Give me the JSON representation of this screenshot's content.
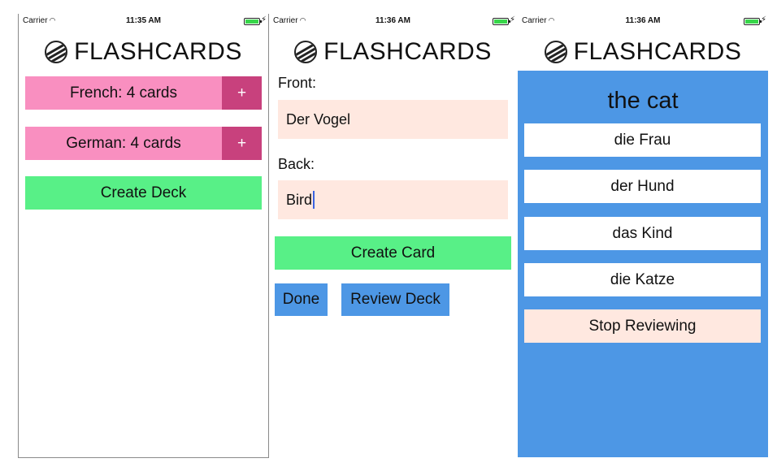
{
  "app_title": "FLASHCARDS",
  "screens": [
    {
      "carrier": "Carrier",
      "time": "11:35 AM"
    },
    {
      "carrier": "Carrier",
      "time": "11:36 AM"
    },
    {
      "carrier": "Carrier",
      "time": "11:36 AM"
    }
  ],
  "decks_screen": {
    "decks": [
      {
        "label": "French: 4 cards",
        "add_label": "+"
      },
      {
        "label": "German: 4 cards",
        "add_label": "+"
      }
    ],
    "create_deck_label": "Create Deck"
  },
  "card_screen": {
    "front_label": "Front:",
    "front_value": "Der Vogel",
    "back_label": "Back:",
    "back_value": "Bird",
    "create_card_label": "Create Card",
    "done_label": "Done",
    "review_deck_label": "Review Deck"
  },
  "review_screen": {
    "prompt": "the cat",
    "choices": [
      "die Frau",
      "der Hund",
      "das Kind",
      "die Katze"
    ],
    "stop_label": "Stop Reviewing",
    "background_color": "#4d97e5"
  },
  "icons": {
    "wifi": "wifi-icon",
    "battery": "battery-icon",
    "charging": "charging-bolt-icon",
    "logo": "zebra-logo-icon"
  }
}
